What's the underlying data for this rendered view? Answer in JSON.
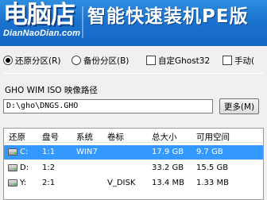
{
  "banner": {
    "logo_main": "电脑店",
    "logo_sub": "DianNaoDian.com",
    "title": "智能快速装机PE版"
  },
  "modes": {
    "restore": "还原分区(R)",
    "backup": "备份分区(B)",
    "custom_ghost": "自定Ghost32",
    "manual": "手动("
  },
  "path": {
    "label": "GHO WIM ISO 映像路径",
    "value": "D:\\gho\\DNGS.GHO",
    "more_button": "更多(M)"
  },
  "table": {
    "headers": [
      "还原",
      "盘号",
      "系统",
      "卷标",
      "总大小",
      "可用空间"
    ],
    "rows": [
      {
        "drive": "C:",
        "disk": "1:1",
        "system": "WIN7",
        "label": "",
        "total": "17.9 GB",
        "free": "9.7 GB"
      },
      {
        "drive": "D:",
        "disk": "1:2",
        "system": "",
        "label": "",
        "total": "33.2 GB",
        "free": "15.5 GB"
      },
      {
        "drive": "Y:",
        "disk": "2:1",
        "system": "",
        "label": "V_DISK",
        "total": "13.4 MB",
        "free": "1.33 MB"
      }
    ]
  },
  "colors": {
    "banner": "#1b73cf",
    "selection": "#3399ff"
  }
}
